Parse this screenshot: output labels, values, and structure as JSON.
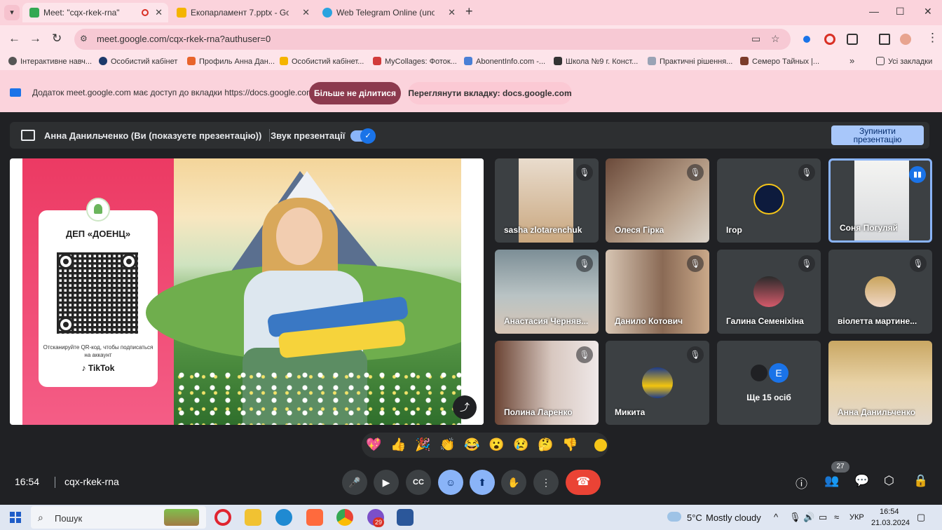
{
  "browser": {
    "tabs": [
      {
        "title": "Meet: \"cqx-rkek-rna\"",
        "active": true,
        "favicon": "google-meet-icon"
      },
      {
        "title": "Екопарламент 7.pptx - Goo",
        "active": false,
        "favicon": "google-slides-icon"
      },
      {
        "title": "Web Telegram Online (unoffici",
        "active": false,
        "favicon": "telegram-icon"
      }
    ],
    "url": "meet.google.com/cqx-rkek-rna?authuser=0",
    "bookmarks": [
      "Інтерактивне навч...",
      "Особистий кабінет",
      "Профиль Анна Дан...",
      "Особистий кабінет...",
      "MyCollages: Фоток...",
      "AbonentInfo.com -...",
      "Школа №9 г. Конст...",
      "Практичні рішення...",
      "Семеро Тайных |..."
    ],
    "all_bookmarks": "Усі закладки"
  },
  "infobar": {
    "message": "Додаток meet.google.com має доступ до вкладки https://docs.google.com",
    "stop_sharing": "Більше не ділитися",
    "view_tab": "Переглянути вкладку: docs.google.com"
  },
  "presenting": {
    "who": "Анна Данильченко (Ви (показуєте презентацію))",
    "sound_label": "Звук презентації",
    "sound_on": true,
    "stop_label_1": "Зупинити",
    "stop_label_2": "презентацію"
  },
  "slide": {
    "card_title": "ДЕП «ДОЕНЦ»",
    "card_caption": "Отсканируйте QR-код, чтобы подписаться на аккаунт",
    "tiktok": "TikTok"
  },
  "participants": [
    {
      "name": "sasha zlotarenchuk",
      "muted": true
    },
    {
      "name": "Олеся Гірка",
      "muted": true
    },
    {
      "name": "Ігор",
      "muted": true
    },
    {
      "name": "Соня Погуляй",
      "muted": false,
      "speaking": true
    },
    {
      "name": "Анастасия Черняв...",
      "muted": true
    },
    {
      "name": "Данило Котович",
      "muted": true
    },
    {
      "name": "Галина Семеніхіна",
      "muted": true
    },
    {
      "name": "віолетта мартине...",
      "muted": true
    },
    {
      "name": "Полина Ларенко",
      "muted": true
    },
    {
      "name": "Микита",
      "muted": true
    },
    {
      "name": "Ще 15 осіб",
      "avatar_letter": "E"
    },
    {
      "name": "Анна Данильченко",
      "muted": false
    }
  ],
  "reactions": [
    "💖",
    "👍",
    "🎉",
    "👏",
    "😂",
    "😮",
    "😢",
    "🤔",
    "👎"
  ],
  "meeting": {
    "time": "16:54",
    "code": "cqx-rkek-rna",
    "participants_count": "27"
  },
  "taskbar": {
    "search": "Пошук",
    "weather_temp": "5°C",
    "weather_desc": "Mostly cloudy",
    "lang": "УКР",
    "time": "16:54",
    "date": "21.03.2024",
    "badge": "29"
  }
}
